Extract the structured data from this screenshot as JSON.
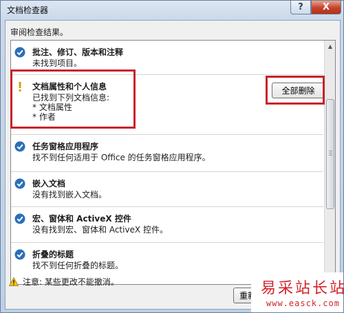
{
  "window": {
    "title": "文档检查器"
  },
  "title_buttons": {
    "help": "?",
    "close": "X"
  },
  "header": {
    "subtitle": "审阅检查结果。"
  },
  "results": [
    {
      "status": "ok",
      "icon": "check-circle-icon",
      "title": "批注、修订、版本和注释",
      "lines": [
        "未找到项目。"
      ]
    },
    {
      "status": "warning",
      "icon": "exclamation-icon",
      "title": "文档属性和个人信息",
      "lines": [
        "已找到下列文档信息:",
        "* 文档属性",
        "* 作者"
      ],
      "action": "全部删除"
    },
    {
      "status": "ok",
      "icon": "check-circle-icon",
      "title": "任务窗格应用程序",
      "lines": [
        "找不到任何适用于 Office 的任务窗格应用程序。"
      ]
    },
    {
      "status": "ok",
      "icon": "check-circle-icon",
      "title": "嵌入文档",
      "lines": [
        "没有找到嵌入文档。"
      ]
    },
    {
      "status": "ok",
      "icon": "check-circle-icon",
      "title": "宏、窗体和 ActiveX 控件",
      "lines": [
        "没有找到宏、窗体和 ActiveX 控件。"
      ]
    },
    {
      "status": "ok",
      "icon": "check-circle-icon",
      "title": "折叠的标题",
      "lines": [
        "找不到任何折叠的标题。"
      ]
    }
  ],
  "footer": {
    "warning_icon": "warning-triangle-icon",
    "warning_text": "注意: 某些更改不能撤消。",
    "recheck_label": "重新"
  },
  "watermark": {
    "logo": "易采站长站",
    "url": "www.easck.com"
  },
  "colors": {
    "check": "#2b6fb8",
    "warning": "#d8a000",
    "highlight": "#c8202a",
    "watermark": "#d2232a"
  }
}
